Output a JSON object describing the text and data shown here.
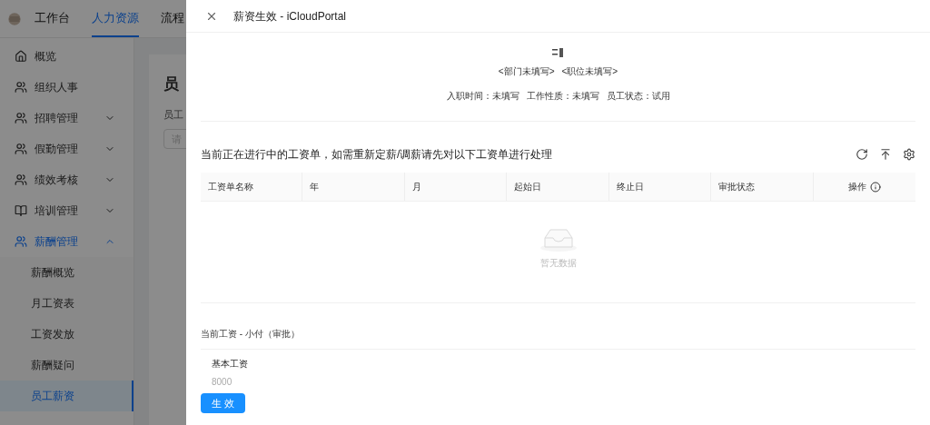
{
  "top_nav": {
    "tabs": [
      {
        "label": "工作台",
        "selected": false
      },
      {
        "label": "人力资源",
        "selected": true
      },
      {
        "label": "流程",
        "selected": false
      }
    ]
  },
  "sidebar": {
    "items": [
      {
        "label": "概览",
        "kind": "home",
        "selected": false
      },
      {
        "label": "组织人事",
        "kind": "people",
        "selected": false
      },
      {
        "label": "招聘管理",
        "kind": "people",
        "expanded": false,
        "selected": false
      },
      {
        "label": "假勤管理",
        "kind": "people",
        "expanded": false,
        "selected": false
      },
      {
        "label": "绩效考核",
        "kind": "people",
        "expanded": false,
        "selected": false
      },
      {
        "label": "培训管理",
        "kind": "book",
        "expanded": false,
        "selected": false
      },
      {
        "label": "薪酬管理",
        "kind": "people",
        "expanded": true,
        "selected": true,
        "children": [
          {
            "label": "薪酬概览",
            "selected": false
          },
          {
            "label": "月工资表",
            "selected": false
          },
          {
            "label": "工资发放",
            "selected": false
          },
          {
            "label": "薪酬疑问",
            "selected": false
          },
          {
            "label": "员工薪资",
            "selected": true
          }
        ]
      }
    ]
  },
  "page": {
    "title": "员",
    "field_label": "员工",
    "field_placeholder": "请"
  },
  "drawer": {
    "title": "薪资生效 - iCloudPortal",
    "profile": {
      "department": "<部门未填写>",
      "position": "<职位未填写>",
      "info": [
        {
          "label": "入职时间：",
          "value": "未填写"
        },
        {
          "label": "工作性质：",
          "value": "未填写"
        },
        {
          "label": "员工状态：",
          "value": "试用"
        }
      ]
    },
    "table": {
      "title": "当前正在进行中的工资单，如需重新定薪/调薪请先对以下工资单进行处理",
      "columns": [
        "工资单名称",
        "年",
        "月",
        "起始日",
        "终止日",
        "审批状态",
        "操作"
      ],
      "empty_text": "暂无数据"
    },
    "current_salary": {
      "title": "当前工资 - 小付（审批）",
      "items": [
        {
          "label": "基本工资",
          "value": "8000"
        }
      ]
    },
    "submit_button": "生 效"
  }
}
